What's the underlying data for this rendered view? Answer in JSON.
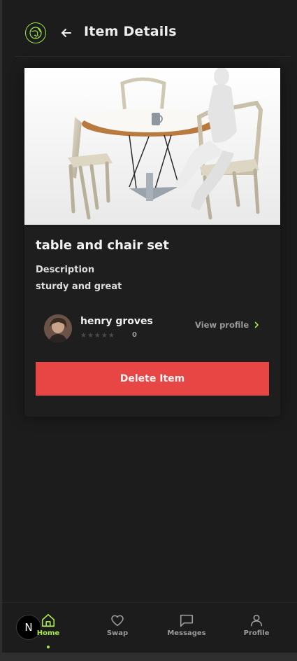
{
  "header": {
    "title": "Item Details",
    "logo_icon": "globe-leaf-icon",
    "back_icon": "arrow-left-icon"
  },
  "item": {
    "title": "table and chair set",
    "description_label": "Description",
    "description": "sturdy and great",
    "image_alt": "table and chair set"
  },
  "owner": {
    "name": "henry groves",
    "stars_filled": 0,
    "stars_total": 5,
    "rating_count": "0",
    "view_profile_label": "View profile"
  },
  "actions": {
    "delete_label": "Delete Item"
  },
  "colors": {
    "accent": "#a6e84d",
    "danger": "#e84545",
    "background": "#1c1c1c"
  },
  "nav": {
    "badge": "N",
    "items": [
      {
        "label": "Home",
        "icon": "home-icon",
        "active": true
      },
      {
        "label": "Swap",
        "icon": "heart-icon",
        "active": false
      },
      {
        "label": "Messages",
        "icon": "message-icon",
        "active": false
      },
      {
        "label": "Profile",
        "icon": "user-icon",
        "active": false
      }
    ]
  }
}
